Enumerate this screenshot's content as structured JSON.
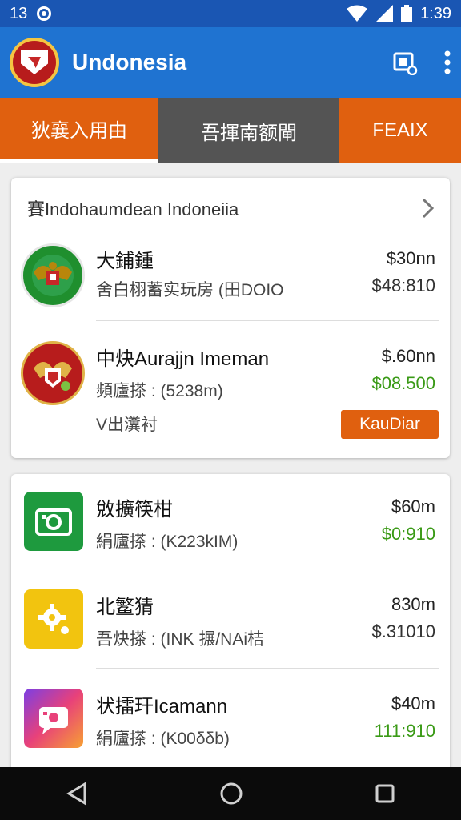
{
  "status": {
    "time_left": "13",
    "time": "1:39"
  },
  "app": {
    "title": "Undonesia"
  },
  "tabs": [
    {
      "label": "狄襄入用由"
    },
    {
      "label": "吾揮南额閘"
    },
    {
      "label": "FEAIX"
    }
  ],
  "card1": {
    "header": "賽Indohaumdean Indoneiia",
    "items": [
      {
        "title": "大鋪鍾",
        "subtitle": "舍白栩蓄实玩房 (田DOIO",
        "price_top": "$30nn",
        "price_bottom": "$48:810",
        "icon": "garuda-emblem-icon"
      },
      {
        "title": "中炔Aurajjn Imeman",
        "subtitle": "頻廬搽 : (5238m)",
        "price_top": "$.60nn",
        "price_bottom": "$08.500",
        "icon": "garuda-shield-icon"
      }
    ],
    "tag": "V出瀵衬",
    "cta": "KauDiar"
  },
  "card2": {
    "items": [
      {
        "title": "敓擴筷柑",
        "subtitle": "絹廬搽 : (K223kIM)",
        "price_top": "$60m",
        "price_bottom": "$0:910",
        "icon": "camera-icon"
      },
      {
        "title": "北鳘猜",
        "subtitle": "吾炔搽 : (INK 搌/NAi桔",
        "price_top": "830m",
        "price_bottom": "$.31010",
        "icon": "gear-icon"
      },
      {
        "title": "状擂玕Icamann",
        "subtitle": "絹廬搽 : (K00δδb)",
        "price_top": "$40m",
        "price_bottom": "111:910",
        "icon": "chat-camera-icon"
      }
    ]
  },
  "colors": {
    "appbar": "#1f73d1",
    "statusbar": "#1a56b3",
    "tab_active": "#e0600f",
    "tab_gray": "#545454",
    "green": "#3a9a16"
  }
}
